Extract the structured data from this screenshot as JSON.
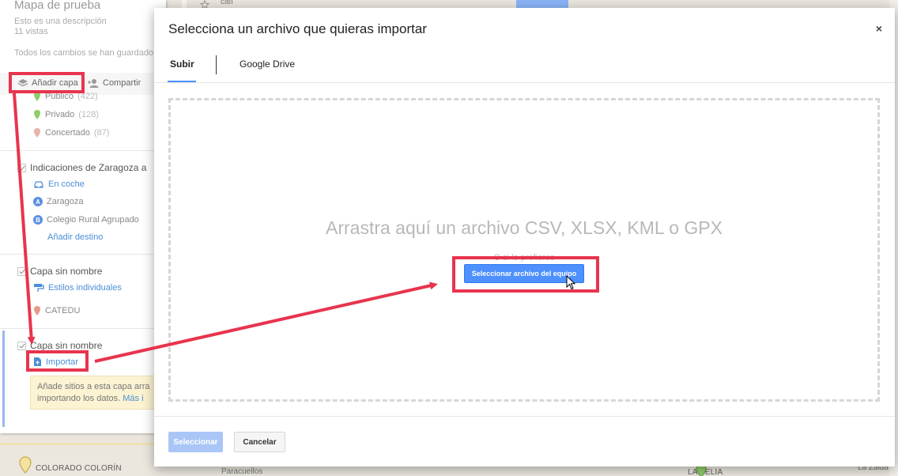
{
  "panel": {
    "title": "Mapa de prueba",
    "description": "Esto es una descripción",
    "views": "11 vistas",
    "saved_status": "Todos los cambios se han guardado",
    "add_layer_label": "Añadir capa",
    "share_label": "Compartir",
    "layer1": {
      "items": [
        {
          "label": "Público",
          "count": "(422)"
        },
        {
          "label": "Privado",
          "count": "(128)"
        },
        {
          "label": "Concertado",
          "count": "(87)"
        }
      ]
    },
    "layer2": {
      "title": "Indicaciones de Zaragoza a",
      "mode": "En coche",
      "point_a": "Zaragoza",
      "point_b": "Colegio Rural Agrupado",
      "add_destination": "Añadir destino"
    },
    "layer3": {
      "title": "Capa sin nombre",
      "style_link": "Estilos individuales",
      "item": "CATEDU"
    },
    "layer4": {
      "title": "Capa sin nombre",
      "import_link": "Importar",
      "tip_line1": "Añade sitios a esta capa arra",
      "tip_line2": "importando los datos.",
      "tip_more": "Más i"
    }
  },
  "map": {
    "labels": [
      "cafi",
      "COLORADO COLORÍN",
      "Paracuellos",
      "LA BELIA",
      "La Zaida"
    ]
  },
  "dialog": {
    "title": "Selecciona un archivo que quieras importar",
    "close_symbol": "×",
    "tabs": [
      {
        "label": "Subir",
        "active": true
      },
      {
        "label": "Google Drive",
        "active": false
      }
    ],
    "drop_text": "Arrastra aquí un archivo CSV, XLSX, KML o GPX",
    "alt_text": "O si lo prefieres",
    "pick_button": "Seleccionar archivo del equipo",
    "select_button": "Seleccionar",
    "cancel_button": "Cancelar"
  },
  "colors": {
    "accent": "#4d90fe",
    "highlight": "#e8344e",
    "pin_green": "#8fce6a",
    "pin_pink": "#e89a8a",
    "tip_bg": "#fcf3d2"
  }
}
